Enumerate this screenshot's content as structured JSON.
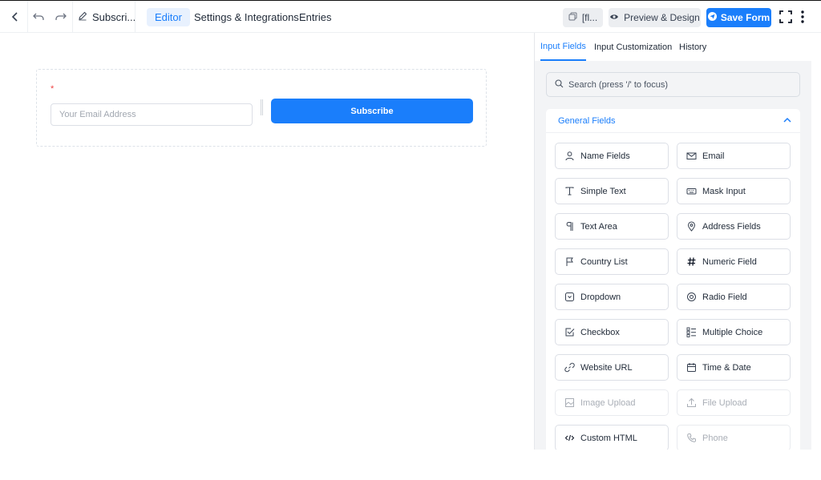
{
  "topbar": {
    "form_name": "Subscri...",
    "tabs": [
      {
        "label": "Editor",
        "active": true
      },
      {
        "label": "Settings & Integrations",
        "active": false
      },
      {
        "label": "Entries",
        "active": false
      }
    ],
    "shortcode_label": "[fl...",
    "preview_label": "Preview & Design",
    "save_label": "Save Form"
  },
  "form": {
    "required_mark": "*",
    "email_placeholder": "Your Email Address",
    "submit_label": "Subscribe"
  },
  "panel": {
    "tabs": [
      {
        "label": "Input Fields",
        "active": true
      },
      {
        "label": "Input Customization",
        "active": false
      },
      {
        "label": "History",
        "active": false
      }
    ],
    "search_placeholder": "Search (press '/' to focus)",
    "section_title": "General Fields",
    "fields": [
      {
        "label": "Name Fields",
        "icon": "user-icon",
        "disabled": false
      },
      {
        "label": "Email",
        "icon": "envelope-icon",
        "disabled": false
      },
      {
        "label": "Simple Text",
        "icon": "text-icon",
        "disabled": false
      },
      {
        "label": "Mask Input",
        "icon": "keyboard-icon",
        "disabled": false
      },
      {
        "label": "Text Area",
        "icon": "paragraph-icon",
        "disabled": false
      },
      {
        "label": "Address Fields",
        "icon": "map-pin-icon",
        "disabled": false
      },
      {
        "label": "Country List",
        "icon": "flag-icon",
        "disabled": false
      },
      {
        "label": "Numeric Field",
        "icon": "hash-icon",
        "disabled": false
      },
      {
        "label": "Dropdown",
        "icon": "dropdown-icon",
        "disabled": false
      },
      {
        "label": "Radio Field",
        "icon": "radio-icon",
        "disabled": false
      },
      {
        "label": "Checkbox",
        "icon": "checkbox-icon",
        "disabled": false
      },
      {
        "label": "Multiple Choice",
        "icon": "list-check-icon",
        "disabled": false
      },
      {
        "label": "Website URL",
        "icon": "link-icon",
        "disabled": false
      },
      {
        "label": "Time & Date",
        "icon": "calendar-icon",
        "disabled": false
      },
      {
        "label": "Image Upload",
        "icon": "image-icon",
        "disabled": true
      },
      {
        "label": "File Upload",
        "icon": "upload-icon",
        "disabled": true
      },
      {
        "label": "Custom HTML",
        "icon": "code-icon",
        "disabled": false
      },
      {
        "label": "Phone",
        "icon": "phone-icon",
        "disabled": true
      }
    ]
  },
  "colors": {
    "accent": "#1a7efb",
    "required": "#ef4444"
  }
}
